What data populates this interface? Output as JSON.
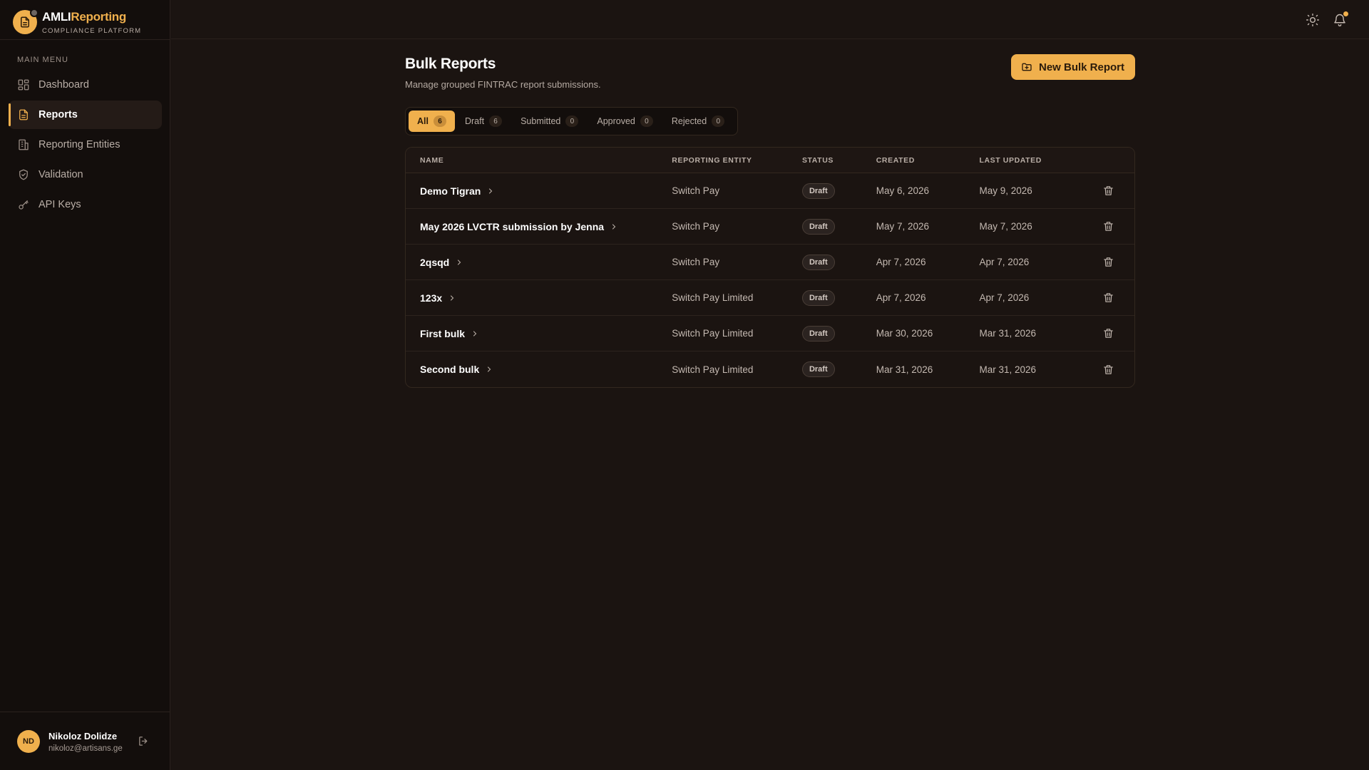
{
  "brand": {
    "name_part1": "AMLI",
    "name_part2": "Reporting",
    "subtitle": "COMPLIANCE PLATFORM",
    "accent_color": "#f0b04d"
  },
  "sidebar": {
    "section_label": "MAIN MENU",
    "items": [
      {
        "label": "Dashboard",
        "icon": "grid-icon",
        "active": false
      },
      {
        "label": "Reports",
        "icon": "document-icon",
        "active": true
      },
      {
        "label": "Reporting Entities",
        "icon": "building-icon",
        "active": false
      },
      {
        "label": "Validation",
        "icon": "shield-check-icon",
        "active": false
      },
      {
        "label": "API Keys",
        "icon": "key-icon",
        "active": false
      }
    ]
  },
  "user": {
    "initials": "ND",
    "name": "Nikoloz Dolidze",
    "email": "nikoloz@artisans.ge"
  },
  "topbar": {
    "icons": [
      "sun-icon",
      "bell-icon"
    ],
    "has_notification": true
  },
  "page": {
    "title": "Bulk Reports",
    "subtitle": "Manage grouped FINTRAC report submissions.",
    "new_button_label": "New Bulk Report"
  },
  "tabs": [
    {
      "label": "All",
      "count": "6",
      "active": true
    },
    {
      "label": "Draft",
      "count": "6",
      "active": false
    },
    {
      "label": "Submitted",
      "count": "0",
      "active": false
    },
    {
      "label": "Approved",
      "count": "0",
      "active": false
    },
    {
      "label": "Rejected",
      "count": "0",
      "active": false
    }
  ],
  "table": {
    "columns": {
      "name": "NAME",
      "entity": "REPORTING ENTITY",
      "status": "STATUS",
      "created": "CREATED",
      "updated": "LAST UPDATED"
    },
    "rows": [
      {
        "name": "Demo Tigran",
        "entity": "Switch Pay",
        "status": "Draft",
        "created": "May 6, 2026",
        "updated": "May 9, 2026"
      },
      {
        "name": "May 2026 LVCTR submission by Jenna",
        "entity": "Switch Pay",
        "status": "Draft",
        "created": "May 7, 2026",
        "updated": "May 7, 2026"
      },
      {
        "name": "2qsqd",
        "entity": "Switch Pay",
        "status": "Draft",
        "created": "Apr 7, 2026",
        "updated": "Apr 7, 2026"
      },
      {
        "name": "123x",
        "entity": "Switch Pay Limited",
        "status": "Draft",
        "created": "Apr 7, 2026",
        "updated": "Apr 7, 2026"
      },
      {
        "name": "First bulk",
        "entity": "Switch Pay Limited",
        "status": "Draft",
        "created": "Mar 30, 2026",
        "updated": "Mar 31, 2026"
      },
      {
        "name": "Second bulk",
        "entity": "Switch Pay Limited",
        "status": "Draft",
        "created": "Mar 31, 2026",
        "updated": "Mar 31, 2026"
      }
    ]
  }
}
